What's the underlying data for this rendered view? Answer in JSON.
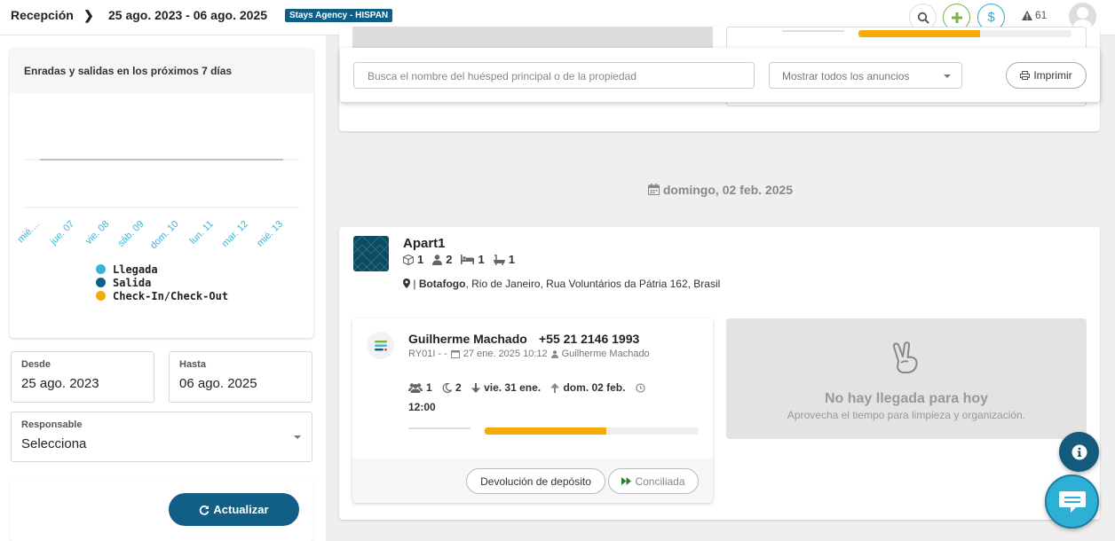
{
  "topbar": {
    "title": "Recepción",
    "date_range": "25 ago. 2023 - 06 ago. 2025",
    "agency_badge": "Stays Agency - HISPAN",
    "alert_count": "61",
    "icons": [
      "chevron-right-icon",
      "search-icon",
      "plus-icon",
      "dollar-icon",
      "warning-icon",
      "avatar"
    ]
  },
  "chart_card": {
    "title": "Enradas y salidas en los próximos 7 días"
  },
  "chart_data": {
    "type": "line",
    "title": "Enradas y salidas en los próximos 7 días",
    "categories": [
      "mié....",
      "jue. 07",
      "vie. 08",
      "sáb. 09",
      "dom. 10",
      "lun. 11",
      "mar. 12",
      "mié. 13"
    ],
    "series": [
      {
        "name": "Llegada",
        "color": "#3cb4d8",
        "values": [
          0,
          0,
          0,
          0,
          0,
          0,
          0,
          0
        ]
      },
      {
        "name": "Salida",
        "color": "#0e5e85",
        "values": [
          0,
          0,
          0,
          0,
          0,
          0,
          0,
          0
        ]
      },
      {
        "name": "Check-In/Check-Out",
        "color": "#f4ab09",
        "values": [
          0,
          0,
          0,
          0,
          0,
          0,
          0,
          0
        ]
      }
    ],
    "tick_color": "#3cb4d8",
    "grid": true,
    "legend_position": "bottom"
  },
  "filters": {
    "from_label": "Desde",
    "from_value": "25 ago. 2023",
    "to_label": "Hasta",
    "to_value": "06 ago. 2025",
    "responsible_label": "Responsable",
    "responsible_value": "Selecciona",
    "refresh_label": "Actualizar"
  },
  "search": {
    "placeholder": "Busca el nombre del huésped principal o de la propiedad",
    "listing_select": "Mostrar todos los anuncios",
    "print_label": "Imprimir"
  },
  "day_heading": "domingo, 02 feb. 2025",
  "property": {
    "name": "Apart1",
    "rooms": "1",
    "guests": "2",
    "beds": "1",
    "baths": "1",
    "address_bold": "Botafogo",
    "address_rest": ", Rio de Janeiro, Rua Voluntários da Pátria 162, Brasil"
  },
  "reservation": {
    "guest_name": "Guilherme Machado",
    "phone": "+55 21 2146 1993",
    "code": "RY01I - -",
    "created": "27 ene. 2025 10:12",
    "created_by": "Guilherme Machado",
    "guests": "1",
    "nights": "2",
    "checkin": "vie. 31 ene.",
    "checkout": "dom. 02 feb.",
    "time": "12:00",
    "progress": 0.57,
    "deposit_button": "Devolución de depósito",
    "reconciled_button": "Conciliada"
  },
  "no_arrival": {
    "title": "No hay llegada para hoy",
    "subtitle": "Aprovecha el tiempo para limpieza y organización."
  },
  "colors": {
    "primary": "#115e87",
    "accent": "#f4ab09",
    "teal": "#3cb4d8"
  }
}
